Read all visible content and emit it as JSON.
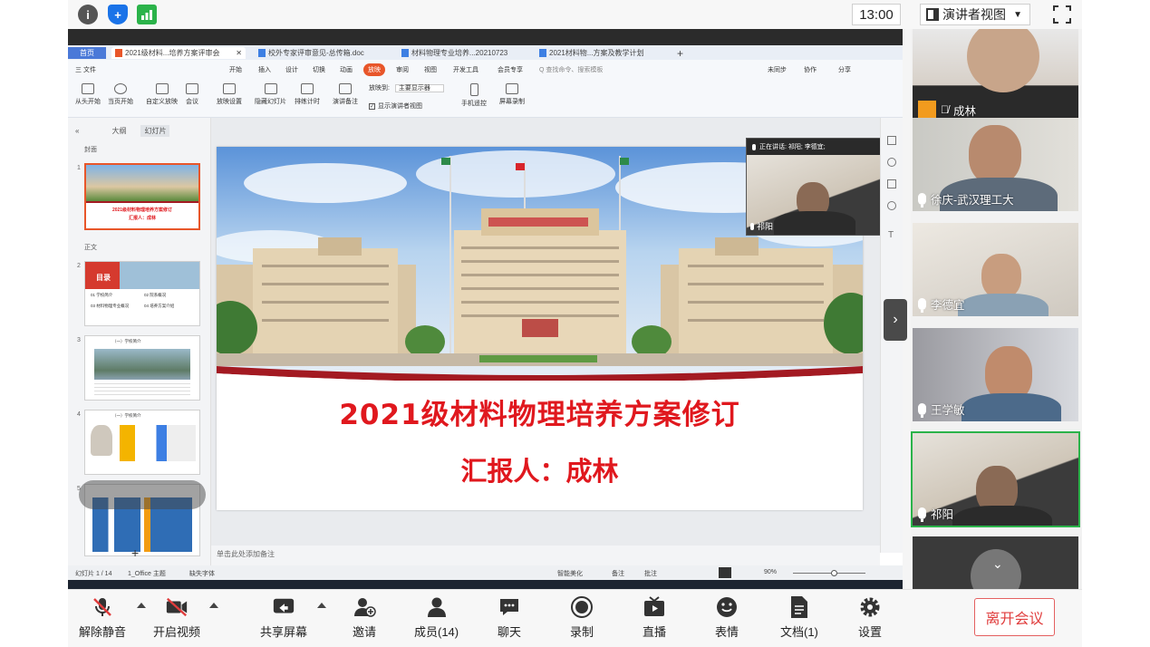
{
  "topbar": {
    "clock": "13:00",
    "view_label": "演讲者视图"
  },
  "ppt": {
    "doc_tabs": [
      {
        "label": "首页"
      },
      {
        "label": "2021级材料...培养方案评审会"
      },
      {
        "label": "校外专家评审意见-总传箱.doc"
      },
      {
        "label": "材料物理专业培养...20210723"
      },
      {
        "label": "2021材料物...方案及教学计划"
      }
    ],
    "menu": [
      "三 文件",
      "开始",
      "插入",
      "设计",
      "切换",
      "动画",
      "放映",
      "审阅",
      "视图",
      "开发工具",
      "会员专享",
      "Q 查找命令、搜索模板"
    ],
    "menu_right": [
      "未同步",
      "协作",
      "分享"
    ],
    "ribbon": [
      "从头开始",
      "当页开始",
      "自定义放映",
      "会议",
      "放映设置",
      "隐藏幻灯片",
      "排练计时",
      "演讲备注",
      "手机遥控",
      "屏幕录制"
    ],
    "ribbon_display_label": "放映到:",
    "ribbon_display_value": "主要显示器",
    "ribbon_presenter_view": "显示演讲者视图",
    "thumb_tabs": [
      "大纲",
      "幻灯片"
    ],
    "section_cover": "封面",
    "section_body": "正文",
    "thumbs": [
      {
        "num": "1",
        "line1": "2021级材料物理培养方案修订",
        "line2": "汇报人：成林"
      },
      {
        "num": "2",
        "tag": "目录",
        "items": [
          "01  学校简介",
          "02  院系概况",
          "03  材料物理专业概况",
          "04  培养方案介绍"
        ]
      },
      {
        "num": "3",
        "caption": "（一）学校简介"
      },
      {
        "num": "4",
        "caption": "（一）学校简介"
      },
      {
        "num": "5",
        "caption": ""
      }
    ],
    "slide": {
      "title": "2021级材料物理培养方案修订",
      "reporter": "汇报人：成林"
    },
    "speaker_header": "正在讲话: 祁阳; 李德宜;",
    "speaker_name": "祁阳",
    "notes_placeholder": "单击此处添加备注",
    "status": {
      "slide_count": "幻灯片 1 / 14",
      "theme": "1_Office 主题",
      "missing_font": "缺失字体",
      "beautify": "智能美化",
      "notes": "备注",
      "comments": "批注",
      "zoom": "90%"
    }
  },
  "videos": [
    {
      "name": "成林",
      "muted": true
    },
    {
      "name": "徐庆-武汉理工大",
      "muted": false
    },
    {
      "name": "李德宜",
      "muted": false
    },
    {
      "name": "王学敏",
      "muted": false
    },
    {
      "name": "祁阳",
      "muted": false
    }
  ],
  "bottombar": {
    "unmute": "解除静音",
    "start_video": "开启视频",
    "share_screen": "共享屏幕",
    "invite": "邀请",
    "members": "成员(14)",
    "chat": "聊天",
    "record": "录制",
    "live": "直播",
    "reactions": "表情",
    "docs": "文档(1)",
    "settings": "设置",
    "leave": "离开会议"
  },
  "colors": {
    "slide_red": "#e0181e",
    "speaking_green": "#2bb34a",
    "leave_red": "#e03c3c"
  }
}
